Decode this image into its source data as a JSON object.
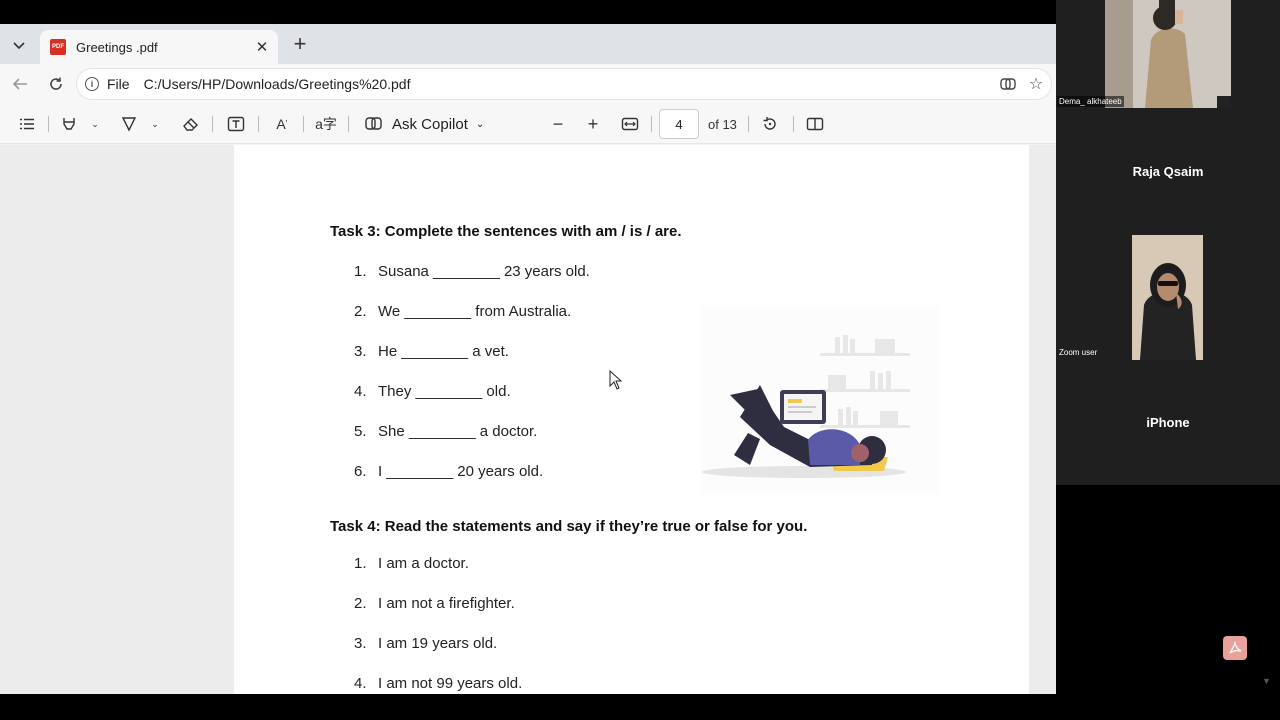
{
  "browser": {
    "tab": {
      "title": "Greetings .pdf",
      "icon_text": "PDF"
    },
    "address": {
      "label": "File",
      "url": "C:/Users/HP/Downloads/Greetings%20.pdf"
    }
  },
  "pdf_toolbar": {
    "ask_copilot": "Ask Copilot",
    "current_page": "4",
    "total_pages": "of 13"
  },
  "document": {
    "task3": {
      "title": "Task 3: Complete the sentences with am / is / are.",
      "items": [
        {
          "num": "1.",
          "text": "Susana ________ 23 years old."
        },
        {
          "num": "2.",
          "text": "We ________ from Australia."
        },
        {
          "num": "3.",
          "text": "He ________ a vet."
        },
        {
          "num": "4.",
          "text": "They ________ old."
        },
        {
          "num": "5.",
          "text": "She ________ a doctor."
        },
        {
          "num": "6.",
          "text": "I ________ 20 years old."
        }
      ]
    },
    "task4": {
      "title": "Task 4: Read the statements and say if they’re true or false for you.",
      "items": [
        {
          "num": "1.",
          "text": "I am a doctor."
        },
        {
          "num": "2.",
          "text": "I am not a firefighter."
        },
        {
          "num": "3.",
          "text": "I am 19 years old."
        },
        {
          "num": "4.",
          "text": "I am not 99 years old."
        }
      ]
    }
  },
  "zoom": {
    "participants": [
      {
        "name": "Dema_ alkhateeb"
      },
      {
        "name": "Raja Qsaim"
      },
      {
        "name": "Zoom user"
      },
      {
        "name": "iPhone"
      }
    ]
  }
}
